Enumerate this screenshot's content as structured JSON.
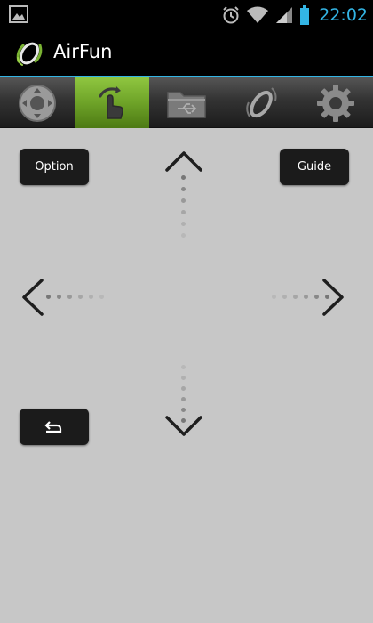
{
  "status_bar": {
    "time": "22:02",
    "icons": [
      "gallery-icon",
      "alarm-icon",
      "wifi-icon",
      "signal-icon",
      "battery-icon"
    ],
    "accent_color": "#33b5e5"
  },
  "action_bar": {
    "title": "AirFun",
    "logo_icon": "airfun-logo-icon"
  },
  "tabs": [
    {
      "name": "dpad-remote",
      "icon": "dpad-icon",
      "active": false
    },
    {
      "name": "touch-gesture",
      "icon": "touch-gesture-icon",
      "active": true
    },
    {
      "name": "files",
      "icon": "usb-folder-icon",
      "active": false
    },
    {
      "name": "air-mouse",
      "icon": "air-mouse-icon",
      "active": false
    },
    {
      "name": "settings",
      "icon": "gear-icon",
      "active": false
    }
  ],
  "remote": {
    "option_label": "Option",
    "guide_label": "Guide",
    "back_icon": "back-arrow-icon",
    "arrows": [
      "up-arrow-icon",
      "left-arrow-icon",
      "right-arrow-icon",
      "down-arrow-icon"
    ]
  },
  "colors": {
    "background": "#c7c7c7",
    "active_tab": "#7ab333",
    "button": "#1b1b1b"
  }
}
